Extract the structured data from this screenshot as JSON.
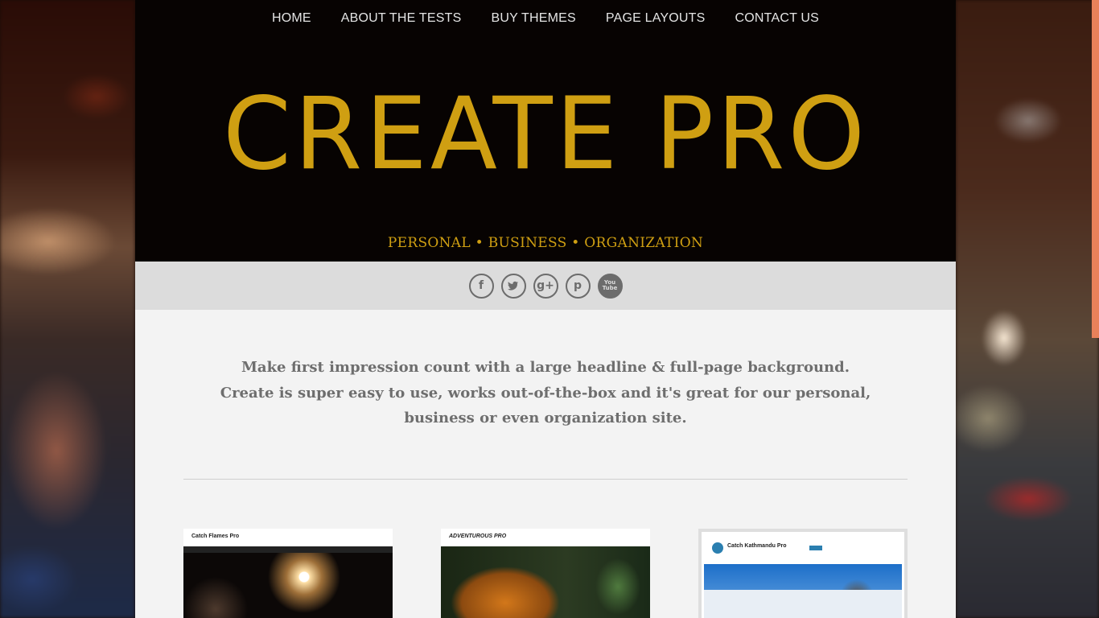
{
  "nav": {
    "items": [
      "HOME",
      "ABOUT THE TESTS",
      "BUY THEMES",
      "PAGE LAYOUTS",
      "CONTACT US"
    ]
  },
  "header": {
    "title": "CREATE PRO",
    "tagline": "PERSONAL • BUSINESS • ORGANIZATION",
    "title_color": "#cf9f12",
    "background": "#070302"
  },
  "social": {
    "icons": [
      "facebook-icon",
      "twitter-icon",
      "google-plus-icon",
      "pinterest-icon",
      "youtube-icon"
    ],
    "youtube_text": "You Tube"
  },
  "intro": {
    "line1": "Make first impression count with a large headline & full-page background.",
    "line2": "Create is super easy to use, works out-of-the-box and it's great for our personal,",
    "line3": "business or even organization site."
  },
  "thumbnails": [
    {
      "title": "Catch Flames Pro"
    },
    {
      "title": "ADVENTUROUS PRO"
    },
    {
      "title": "Catch Kathmandu Pro"
    }
  ]
}
